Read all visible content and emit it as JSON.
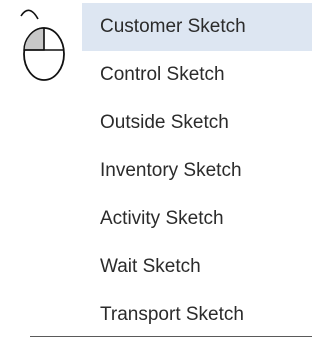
{
  "menu": {
    "selected_index": 0,
    "items": [
      {
        "label": "Customer Sketch"
      },
      {
        "label": "Control Sketch"
      },
      {
        "label": "Outside Sketch"
      },
      {
        "label": "Inventory Sketch"
      },
      {
        "label": "Activity Sketch"
      },
      {
        "label": "Wait Sketch"
      },
      {
        "label": "Transport Sketch"
      }
    ]
  },
  "cursor": {
    "icon": "mouse-pointer-icon",
    "pressed_button": "left"
  },
  "colors": {
    "selected_bg": "#dde6f2",
    "text": "#2b2b2b",
    "border": "#5a5a5a"
  }
}
